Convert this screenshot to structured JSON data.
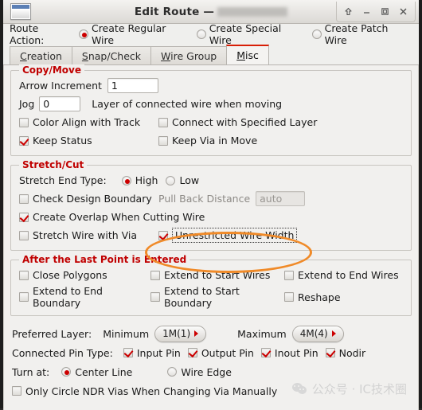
{
  "window": {
    "title_main": "Edit Route",
    "title_separator": "—",
    "title_redacted": true,
    "buttons": {
      "rollup": "rollup-icon",
      "minimize": "minimize-icon",
      "maximize": "maximize-icon",
      "close": "close-icon"
    },
    "app_icon": "window-icon"
  },
  "route_action": {
    "label": "Route Action:",
    "options": [
      {
        "label": "Create Regular Wire",
        "selected": true
      },
      {
        "label": "Create Special Wire",
        "selected": false
      },
      {
        "label": "Create Patch Wire",
        "selected": false
      }
    ]
  },
  "tabs": [
    {
      "label": "Creation",
      "mnemonic": "C",
      "active": false
    },
    {
      "label": "Snap/Check",
      "mnemonic": "S",
      "active": false
    },
    {
      "label": "Wire Group",
      "mnemonic": "W",
      "active": false
    },
    {
      "label": "Misc",
      "mnemonic": "M",
      "active": true
    }
  ],
  "copy_move": {
    "legend": "Copy/Move",
    "arrow_increment_label": "Arrow Increment",
    "arrow_increment_value": "1",
    "jog_label": "Jog",
    "jog_value": "0",
    "jog_suffix": "Layer of connected wire when moving",
    "checkboxes": [
      {
        "label": "Color Align with Track",
        "checked": false
      },
      {
        "label": "Connect with Specified Layer",
        "checked": false
      },
      {
        "label": "Keep Status",
        "checked": true
      },
      {
        "label": "Keep Via in Move",
        "checked": false
      }
    ]
  },
  "stretch_cut": {
    "legend": "Stretch/Cut",
    "end_type_label": "Stretch End Type:",
    "end_type_options": [
      {
        "label": "High",
        "selected": true
      },
      {
        "label": "Low",
        "selected": false
      }
    ],
    "check_design_boundary": {
      "label": "Check Design Boundary",
      "checked": false
    },
    "pull_back_label": "Pull Back Distance",
    "pull_back_value": "auto",
    "pull_back_disabled": true,
    "create_overlap": {
      "label": "Create Overlap When Cutting Wire",
      "checked": true
    },
    "stretch_wire_with_via": {
      "label": "Stretch Wire with Via",
      "checked": false
    },
    "unrestricted_wire_width": {
      "label": "Unrestricted Wire Width",
      "checked": true,
      "focused": true,
      "annotated": true
    }
  },
  "after_last_point": {
    "legend": "After the Last Point is Entered",
    "checkboxes": [
      {
        "label": "Close Polygons",
        "checked": false
      },
      {
        "label": "Extend to Start Wires",
        "checked": false
      },
      {
        "label": "Extend to End Wires",
        "checked": false
      },
      {
        "label": "Extend to End Boundary",
        "checked": false
      },
      {
        "label": "Extend to Start Boundary",
        "checked": false
      },
      {
        "label": "Reshape",
        "checked": false
      }
    ]
  },
  "preferred_layer": {
    "label": "Preferred Layer:",
    "minimum_label": "Minimum",
    "minimum_value": "1M(1)",
    "maximum_label": "Maximum",
    "maximum_value": "4M(4)"
  },
  "connected_pin_type": {
    "label": "Connected Pin Type:",
    "options": [
      {
        "label": "Input Pin",
        "checked": true
      },
      {
        "label": "Output Pin",
        "checked": true
      },
      {
        "label": "Inout Pin",
        "checked": true
      },
      {
        "label": "Nodir",
        "checked": true
      }
    ]
  },
  "turn_at": {
    "label": "Turn at:",
    "options": [
      {
        "label": "Center Line",
        "selected": true
      },
      {
        "label": "Wire Edge",
        "selected": false
      }
    ]
  },
  "only_circle_ndr": {
    "label": "Only Circle NDR Vias When Changing Via Manually",
    "checked": false
  },
  "watermark": {
    "text": "公众号 · IC技术圈",
    "logo": "wechat-icon"
  },
  "colors": {
    "legend_red": "#c00000",
    "accent_red": "#cc0000",
    "tab_active_top": "#d81e06",
    "annotation_orange": "#f08a28",
    "panel_bg": "#f1f0ee"
  }
}
